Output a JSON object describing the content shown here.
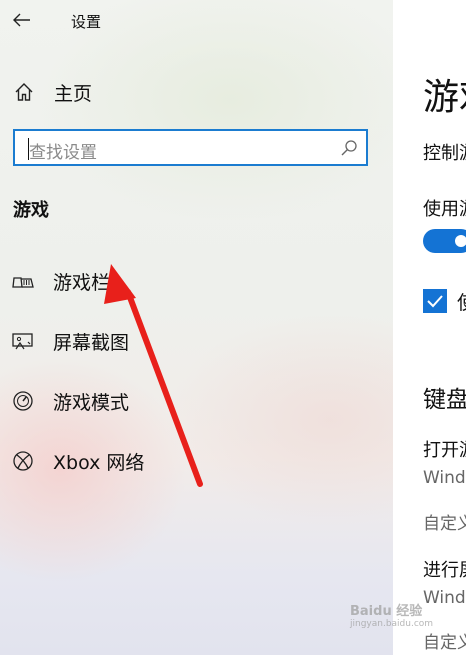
{
  "window": {
    "title": "设置"
  },
  "sidebar": {
    "home_label": "主页",
    "search": {
      "placeholder": "查找设置"
    },
    "section_title": "游戏",
    "items": [
      {
        "label": "游戏栏",
        "icon": "game-bar-icon"
      },
      {
        "label": "屏幕截图",
        "icon": "capture-icon"
      },
      {
        "label": "游戏模式",
        "icon": "game-mode-icon"
      },
      {
        "label": "Xbox 网络",
        "icon": "xbox-icon"
      }
    ]
  },
  "main": {
    "page_title": "游戏",
    "desc": "控制游",
    "toggle_label": "使用游",
    "toggle_on": true,
    "checkbox_checked": true,
    "checkbox_label": "使",
    "keyboard_heading": "键盘",
    "shortcut1_title": "打开游",
    "shortcut1_value": "Wind",
    "shortcut1_custom": "自定义",
    "shortcut2_title": "进行屏",
    "shortcut2_value": "Wind",
    "shortcut2_custom": "自定义"
  },
  "watermark": {
    "text": "Baidu 经验",
    "sub": "jingyan.baidu.com"
  },
  "colors": {
    "accent": "#1473d4",
    "annotation_arrow": "#e8201b"
  }
}
